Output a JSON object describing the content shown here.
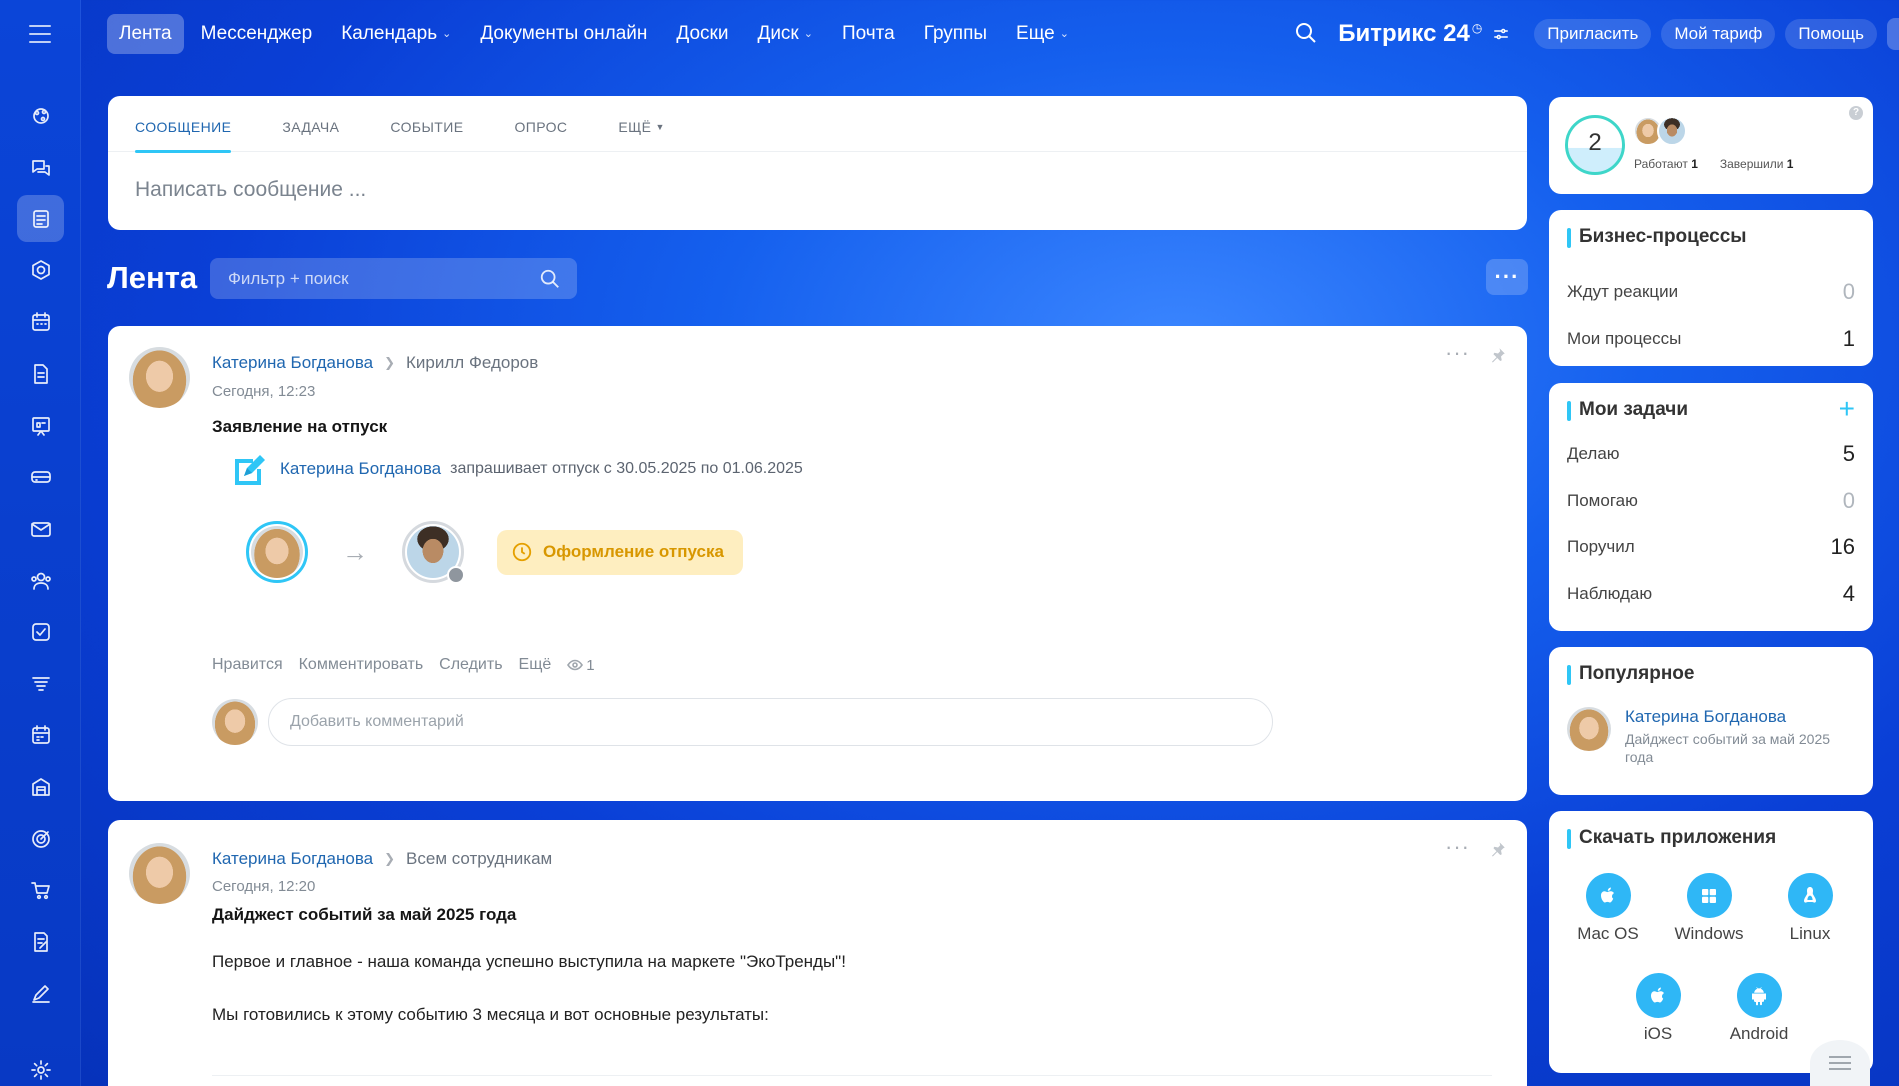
{
  "topnav": {
    "items": [
      {
        "label": "Лента",
        "active": true,
        "dropdown": false
      },
      {
        "label": "Мессенджер",
        "active": false,
        "dropdown": false
      },
      {
        "label": "Календарь",
        "active": false,
        "dropdown": true
      },
      {
        "label": "Документы онлайн",
        "active": false,
        "dropdown": false
      },
      {
        "label": "Доски",
        "active": false,
        "dropdown": false
      },
      {
        "label": "Диск",
        "active": false,
        "dropdown": true
      },
      {
        "label": "Почта",
        "active": false,
        "dropdown": false
      },
      {
        "label": "Группы",
        "active": false,
        "dropdown": false
      },
      {
        "label": "Еще",
        "active": false,
        "dropdown": true
      }
    ],
    "brand": "Битрикс 24",
    "invite": "Пригласить",
    "tariff": "Мой тариф",
    "help": "Помощь"
  },
  "sidebar": {
    "icons": [
      "copilot-icon",
      "messenger-icon",
      "feed-icon",
      "groups-icon",
      "calendar-icon",
      "documents-icon",
      "boards-icon",
      "drive-icon",
      "mail-icon",
      "employees-icon",
      "tasks-icon",
      "crm-filter-icon",
      "booking-icon",
      "inventory-icon",
      "goals-icon",
      "shop-icon",
      "contracts-icon",
      "sign-icon",
      "settings-icon"
    ],
    "active": "feed-icon"
  },
  "composer": {
    "tabs": [
      "Сообщение",
      "Задача",
      "Событие",
      "Опрос",
      "Ещё"
    ],
    "placeholder": "Написать сообщение ..."
  },
  "feed": {
    "title": "Лента",
    "filter_placeholder": "Фильтр + поиск"
  },
  "post1": {
    "author": "Катерина Богданова",
    "recipient": "Кирилл Федоров",
    "time": "Сегодня, 12:23",
    "title": "Заявление на отпуск",
    "request_author": "Катерина Богданова",
    "request_text": "запрашивает отпуск с 30.05.2025 по 01.06.2025",
    "status": "Оформление отпуска",
    "actions": [
      "Нравится",
      "Комментировать",
      "Следить",
      "Ещё"
    ],
    "views": "1",
    "comment_placeholder": "Добавить комментарий"
  },
  "post2": {
    "author": "Катерина Богданова",
    "recipient": "Всем сотрудникам",
    "time": "Сегодня, 12:20",
    "title": "Дайджест событий за май 2025 года",
    "line1": "Первое и главное - наша команда успешно выступила на маркете \"ЭкоТренды\"!",
    "line2": "Мы готовились к этому событию 3 месяца и вот основные результаты:"
  },
  "summary": {
    "count": "2",
    "working_label": "Работают",
    "working_count": "1",
    "done_label": "Завершили",
    "done_count": "1"
  },
  "bizproc": {
    "title": "Бизнес-процессы",
    "rows": [
      {
        "label": "Ждут реакции",
        "value": "0"
      },
      {
        "label": "Мои процессы",
        "value": "1"
      }
    ]
  },
  "tasks": {
    "title": "Мои задачи",
    "rows": [
      {
        "label": "Делаю",
        "value": "5"
      },
      {
        "label": "Помогаю",
        "value": "0"
      },
      {
        "label": "Поручил",
        "value": "16"
      },
      {
        "label": "Наблюдаю",
        "value": "4"
      }
    ]
  },
  "popular": {
    "title": "Популярное",
    "author": "Катерина Богданова",
    "desc": "Дайджест событий за май 2025 года"
  },
  "apps": {
    "title": "Скачать приложения",
    "items": [
      "Mac OS",
      "Windows",
      "Linux",
      "iOS",
      "Android"
    ]
  }
}
